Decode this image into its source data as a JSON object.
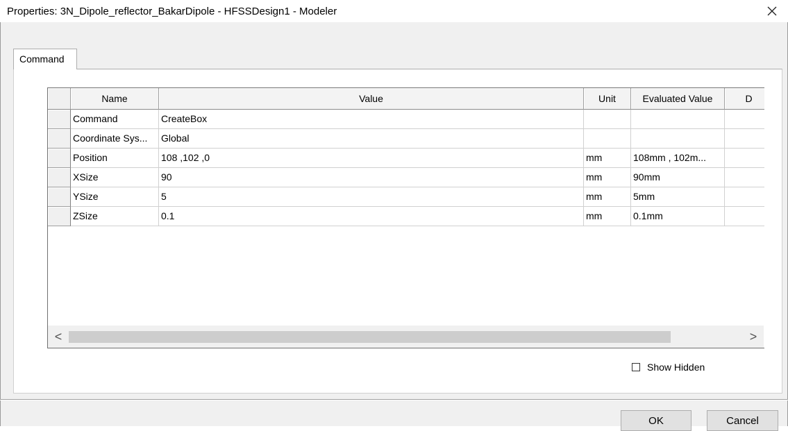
{
  "window": {
    "title": "Properties: 3N_Dipole_reflector_BakarDipole - HFSSDesign1 - Modeler",
    "close_glyph": "close-icon"
  },
  "tabs": [
    {
      "label": "Command"
    }
  ],
  "table": {
    "columns": [
      "Name",
      "Value",
      "Unit",
      "Evaluated Value",
      "D"
    ],
    "rows": [
      {
        "name": "Command",
        "value": "CreateBox",
        "unit": "",
        "evaluated": ""
      },
      {
        "name": "Coordinate Sys...",
        "value": "Global",
        "unit": "",
        "evaluated": ""
      },
      {
        "name": "Position",
        "value": "108 ,102 ,0",
        "unit": "mm",
        "evaluated": "108mm , 102m..."
      },
      {
        "name": "XSize",
        "value": "90",
        "unit": "mm",
        "evaluated": "90mm"
      },
      {
        "name": "YSize",
        "value": "5",
        "unit": "mm",
        "evaluated": "5mm"
      },
      {
        "name": "ZSize",
        "value": "0.1",
        "unit": "mm",
        "evaluated": "0.1mm"
      }
    ]
  },
  "scrollbar": {
    "left_glyph": "<",
    "right_glyph": ">"
  },
  "show_hidden": {
    "label": "Show Hidden",
    "checked": false
  },
  "buttons": {
    "ok": "OK",
    "cancel": "Cancel"
  }
}
